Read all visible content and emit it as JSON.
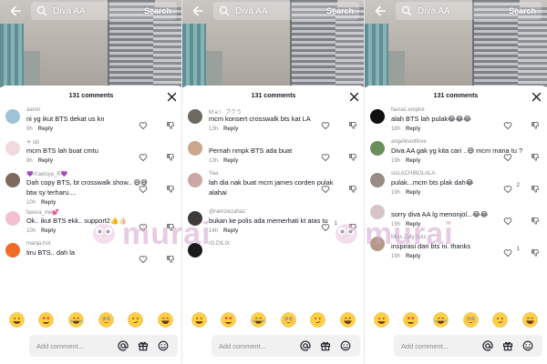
{
  "search": {
    "query": "Diva AA",
    "button_label": "Search"
  },
  "sheet_title": "131 comments",
  "input_placeholder": "Add comment...",
  "reply_label": "Reply",
  "watermark_text": "murai",
  "emojis": [
    "grin",
    "heart-eyes",
    "joy",
    "flushed",
    "smirk",
    "laughing"
  ],
  "colors": {
    "accent_text": "#161823",
    "muted": "#8a8b91",
    "watermark": "#d4a3cd"
  },
  "panels": [
    {
      "comments": [
        {
          "user": "aaron",
          "text": "ni yg ikut BTS dekat us kn",
          "time": "9h",
          "likes": "",
          "avatar_color": "#9fc3d6"
        },
        {
          "user": "✳ siti",
          "text": "mcm BTS lah buat cmtu",
          "time": "9h",
          "likes": "",
          "avatar_color": "#f3d9de"
        },
        {
          "user": "💜A'aeisya_R💜",
          "text": "Dah copy BTS, bt crosswalk show.. 😅😅",
          "text2": "btw sy terharu....",
          "time": "10h",
          "likes": "",
          "avatar_color": "#7e6a5c"
        },
        {
          "user": "faxora_me💕",
          "text": "Ok.. ikut BTS ekk.. support2👍👍🏻",
          "time": "10h",
          "likes": "",
          "avatar_color": "#f2c1cf"
        },
        {
          "user": "manja.hot",
          "text": "tiru BTS.. dah la",
          "time": "",
          "likes": "",
          "avatar_color": "#f06b2a"
        }
      ]
    },
    {
      "comments": [
        {
          "user": "M a l .  ブクう",
          "text": "mcm konsert crosswalk bts kat LA",
          "time": "13h",
          "likes": "",
          "avatar_color": "#6e6a63"
        },
        {
          "user": "",
          "text": "Pernah nmpk BTS ada buat",
          "time": "13h",
          "likes": "",
          "avatar_color": "#c9a68d"
        },
        {
          "user": "Yaa",
          "text": "lah dia nak buat mcm james corden pulak",
          "text2": "alahai",
          "time": "",
          "likes": "",
          "avatar_color": "#caa9a5"
        },
        {
          "user": "@ramziezahaz",
          "text": "bukan ke polis ada memerhati kt atas tu",
          "time": "14h",
          "likes": "1",
          "avatar_color": "#3e3b38"
        },
        {
          "user": "IG.DILIX",
          "text": "",
          "time": "",
          "likes": "",
          "avatar_color": "#1a1a1a"
        }
      ]
    },
    {
      "comments": [
        {
          "user": "fauraz.empire",
          "text": "alah BTS lah pulak😂😂😂",
          "time": "18h",
          "likes": "",
          "avatar_color": "#111111"
        },
        {
          "user": "angelineoflove",
          "text": "Diva AA gak yg kita cari ..😅 mcm mana tu ?",
          "time": "19h",
          "likes": "",
          "avatar_color": "#6b8f5a"
        },
        {
          "user": "sisLACHIBOLALA",
          "text": "pulak...mcm bts plak dah😂",
          "time": "19h",
          "likes": "2",
          "avatar_color": "#9a8b86"
        },
        {
          "user": "",
          "text": "sorry diva AA lg menonjol...😂😂",
          "time": "19h",
          "likes": "",
          "avatar_color": "#d7c4c6"
        },
        {
          "user": "Miss Zaty Aziz",
          "text": "inspirasi dari bts ni. thanks",
          "time": "19h",
          "likes": "1",
          "avatar_color": "#b49a86"
        }
      ]
    }
  ]
}
